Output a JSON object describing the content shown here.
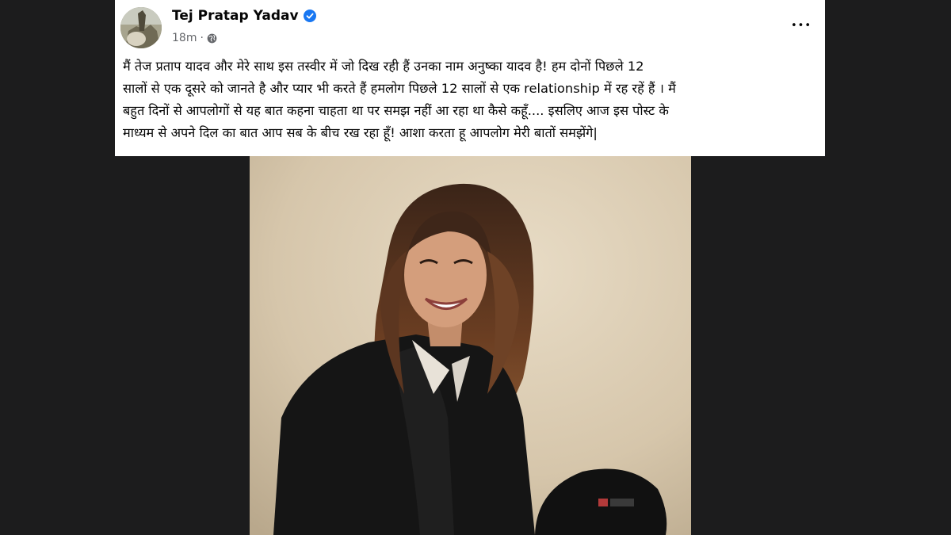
{
  "post": {
    "author": "Tej Pratap Yadav",
    "timestamp": "18m",
    "separator": "·",
    "more_label": "•••",
    "text": "मैं तेज प्रताप यादव और  मेरे साथ इस तस्वीर में जो दिख रही हैं उनका नाम अनुष्का यादव है! हम दोनों पिछले 12\nसालों से एक दूसरे को जानते है और प्यार भी करते हैं हमलोग पिछले 12 सालों से एक relationship में रह रहें हैं । मैं\nबहुत दिनों से आपलोगों से यह बात कहना चाहता था पर समझ नहीं आ रहा था कैसे कहूँ.... इसलिए आज इस पोस्ट के\nमाध्यम से अपने दिल का बात आप सब के बीच रख रहा हूँ! आशा करता हू आपलोग मेरी बातों समझेंगे|"
  },
  "colors": {
    "background": "#1c1c1d",
    "card": "#ffffff",
    "verified": "#1877f2",
    "meta": "#65676b"
  },
  "icons": {
    "verified": "verified-badge-icon",
    "privacy": "globe-icon",
    "more": "more-horizontal-icon"
  }
}
